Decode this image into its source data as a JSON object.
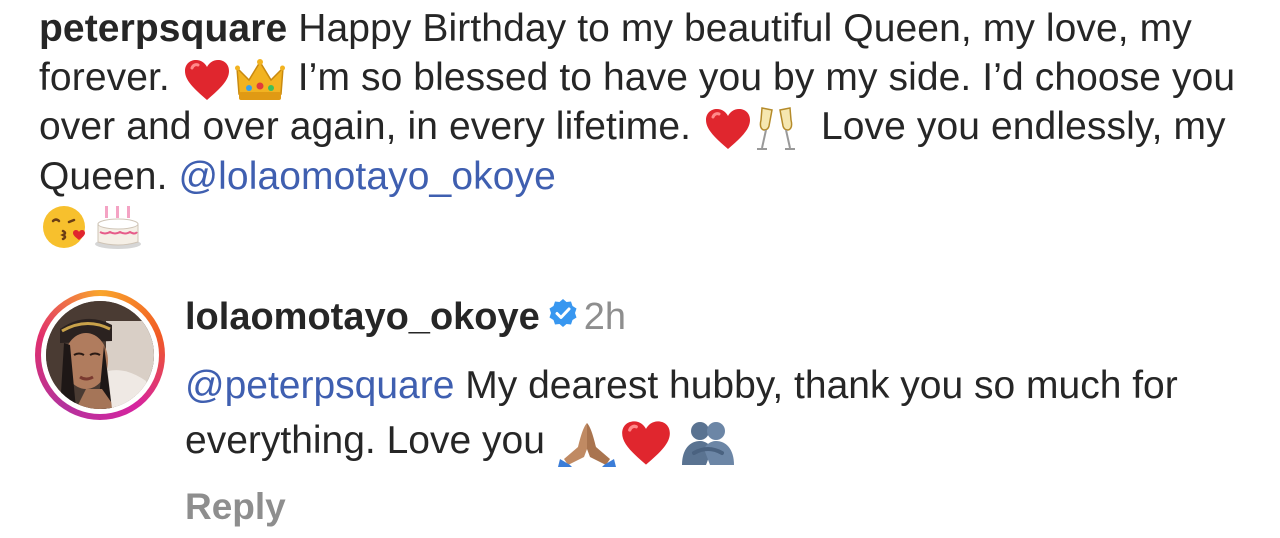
{
  "post_caption": {
    "username": "peterpsquare",
    "text_1": "Happy Birthday to my beautiful Queen, my love, my forever.",
    "text_2": "I’m so blessed to have you by my side. I’d choose you over and over again, in every lifetime.",
    "text_3": "Love you endlessly, my Queen.",
    "mention": "@lolaomotayo_okoye",
    "emojis_1": [
      "heart-icon",
      "crown-icon"
    ],
    "emojis_2": [
      "heart-icon",
      "champagne-icon"
    ],
    "emojis_3": [
      "kiss-face-icon",
      "birthday-cake-icon"
    ]
  },
  "reply": {
    "username": "lolaomotayo_okoye",
    "verified": true,
    "time": "2h",
    "mention": "@peterpsquare",
    "text": "My dearest hubby, thank you so much for everything. Love you",
    "emojis": [
      "praying-hands-icon",
      "heart-icon",
      "hugging-people-icon"
    ],
    "action_label": "Reply"
  },
  "colors": {
    "text": "#262626",
    "mention": "#3f5fb0",
    "secondary": "#8e8e8e",
    "verified": "#3897f0",
    "heart": "#e0262e"
  }
}
